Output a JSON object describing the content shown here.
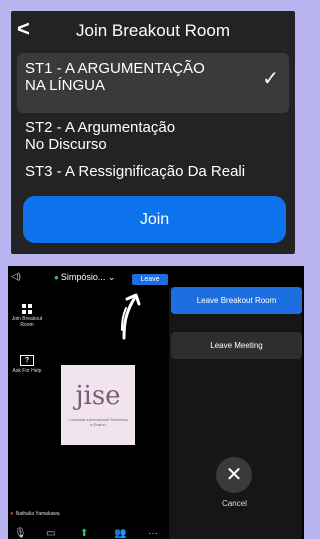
{
  "dialog": {
    "title": "Join Breakout Room",
    "rooms": [
      {
        "line1": "ST1 - A ARGUMENTAÇÃO",
        "line2": "NA LÍNGUA",
        "selected": true
      },
      {
        "line1": "ST2 - A Argumentação",
        "line2": "No Discurso",
        "selected": false
      },
      {
        "line1": "ST3 - A Ressignificação Da Reali",
        "line2": "",
        "selected": false
      }
    ],
    "join_label": "Join"
  },
  "meeting": {
    "name": "Simpósio...",
    "leave_label": "Leave",
    "sidebar": {
      "breakout_label": "Join Breakout Room",
      "help_label": "Ask For Help",
      "help_icon_text": "?"
    },
    "video": {
      "logo_text": "jise",
      "logo_sub": "I Jornada Internacional Semiótica e Ensino"
    },
    "participant_name": "Nathalia Yamakawa",
    "leave_panel": {
      "leave_breakout_label": "Leave Breakout Room",
      "leave_meeting_label": "Leave Meeting",
      "cancel_label": "Cancel"
    }
  },
  "colors": {
    "background": "#b9b3ef",
    "accent": "#0e72ed",
    "dialog_bg": "#232325"
  }
}
